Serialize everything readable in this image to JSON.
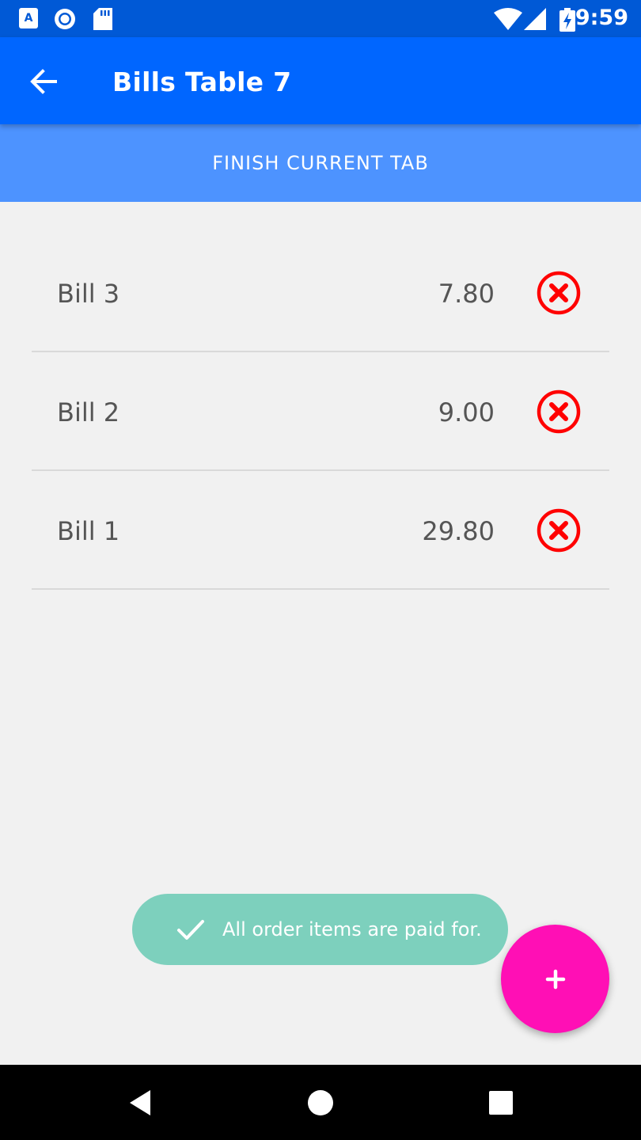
{
  "status_bar": {
    "time": "9:59",
    "left_icons": [
      "a-notification-icon",
      "circle-notification-icon",
      "sd-card-icon"
    ],
    "right_icons": [
      "wifi-icon",
      "signal-icon",
      "battery-charging-icon"
    ]
  },
  "app_bar": {
    "title": "Bills Table 7",
    "back_icon": "arrow-back-icon"
  },
  "finish_button": {
    "label": "FINISH CURRENT TAB"
  },
  "bills": [
    {
      "name": "Bill 3",
      "amount": "7.80"
    },
    {
      "name": "Bill 2",
      "amount": "9.00"
    },
    {
      "name": "Bill 1",
      "amount": "29.80"
    }
  ],
  "toast": {
    "message": "All order items are paid for.",
    "icon": "check-icon"
  },
  "fab": {
    "label": "+"
  },
  "colors": {
    "status_bar": "#0059d6",
    "app_bar": "#0066ff",
    "finish_button": "#4d93ff",
    "delete_icon": "#ff0000",
    "toast": "#7dd0bd",
    "fab": "#ff0fb5"
  }
}
